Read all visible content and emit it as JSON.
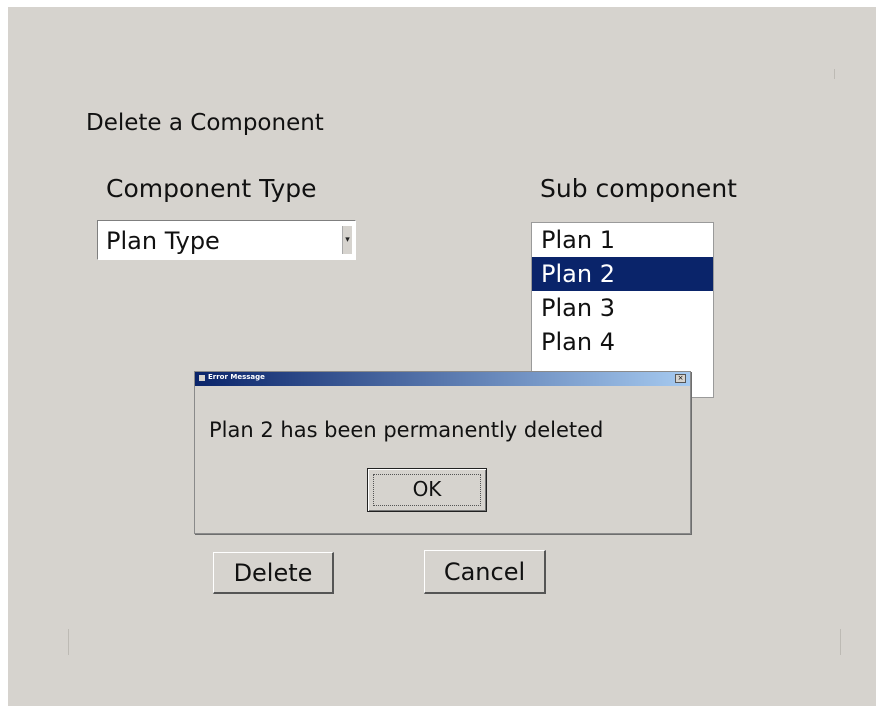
{
  "form": {
    "heading": "Delete a Component",
    "component_type_label": "Component Type",
    "component_type_value": "Plan Type",
    "sub_component_label": "Sub component",
    "sub_components": [
      "Plan 1",
      "Plan 2",
      "Plan 3",
      "Plan 4"
    ],
    "selected_sub_component": "Plan 2",
    "delete_label": "Delete",
    "cancel_label": "Cancel"
  },
  "dialog": {
    "title": "Error Message",
    "close_glyph": "×",
    "message": "Plan 2 has been permanently deleted",
    "ok_label": "OK"
  },
  "colors": {
    "background": "#d6d3ce",
    "selection": "#0a246a",
    "titlebar_start": "#0a246a",
    "titlebar_end": "#a6caf0"
  }
}
